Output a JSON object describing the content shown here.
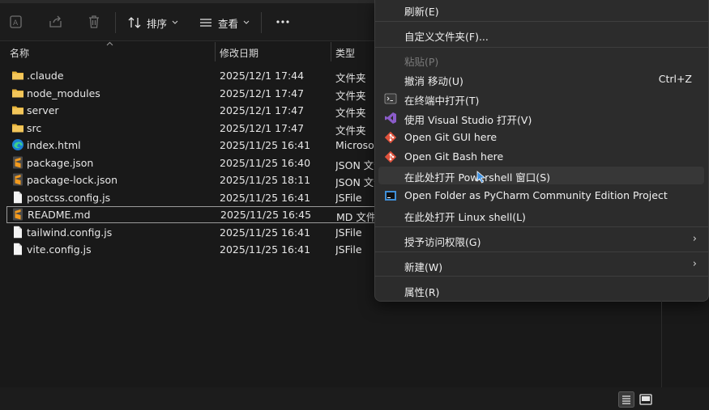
{
  "toolbar": {
    "sort_label": "排序",
    "view_label": "查看",
    "more_label": "···",
    "icons": [
      "rename-icon",
      "share-icon",
      "delete-icon",
      "sort-icon",
      "view-icon",
      "more-icon"
    ]
  },
  "columns": {
    "name": "名称",
    "modified": "修改日期",
    "type": "类型"
  },
  "files": [
    {
      "name": ".claude",
      "date": "2025/12/1 17:44",
      "type": "文件夹",
      "icon": "folder-icon"
    },
    {
      "name": "node_modules",
      "date": "2025/12/1 17:47",
      "type": "文件夹",
      "icon": "folder-icon"
    },
    {
      "name": "server",
      "date": "2025/12/1 17:47",
      "type": "文件夹",
      "icon": "folder-icon"
    },
    {
      "name": "src",
      "date": "2025/12/1 17:47",
      "type": "文件夹",
      "icon": "folder-icon"
    },
    {
      "name": "index.html",
      "date": "2025/11/25 16:41",
      "type": "Microso",
      "icon": "edge-html-icon"
    },
    {
      "name": "package.json",
      "date": "2025/11/25 16:40",
      "type": "JSON 文件",
      "icon": "sublime-file-icon"
    },
    {
      "name": "package-lock.json",
      "date": "2025/11/25 18:11",
      "type": "JSON 文件",
      "icon": "sublime-file-icon"
    },
    {
      "name": "postcss.config.js",
      "date": "2025/11/25 16:41",
      "type": "JSFile",
      "icon": "blank-file-icon"
    },
    {
      "name": "README.md",
      "date": "2025/11/25 16:45",
      "type": "MD 文件",
      "icon": "sublime-file-icon",
      "selected": true
    },
    {
      "name": "tailwind.config.js",
      "date": "2025/11/25 16:41",
      "type": "JSFile",
      "icon": "blank-file-icon"
    },
    {
      "name": "vite.config.js",
      "date": "2025/11/25 16:41",
      "type": "JSFile",
      "icon": "blank-file-icon"
    }
  ],
  "context_menu": {
    "refresh": "刷新(E)",
    "customize": "自定义文件夹(F)...",
    "paste": "粘贴(P)",
    "undo_move": "撤消 移动(U)",
    "undo_shortcut": "Ctrl+Z",
    "open_terminal": "在终端中打开(T)",
    "open_vs": "使用 Visual Studio 打开(V)",
    "git_gui": "Open Git GUI here",
    "git_bash": "Open Git Bash here",
    "powershell": "在此处打开 Powershell 窗口(S)",
    "pycharm": "Open Folder as PyCharm Community Edition Project",
    "linux_shell": "在此处打开 Linux shell(L)",
    "give_access": "授予访问权限(G)",
    "new": "新建(W)",
    "properties": "属性(R)"
  },
  "colors": {
    "folder": "#e8b43a",
    "sublime": "#f29a1e",
    "edge_blue": "#1a7fd4",
    "vs_purple": "#8b5cc9",
    "git_red": "#e0523c"
  }
}
